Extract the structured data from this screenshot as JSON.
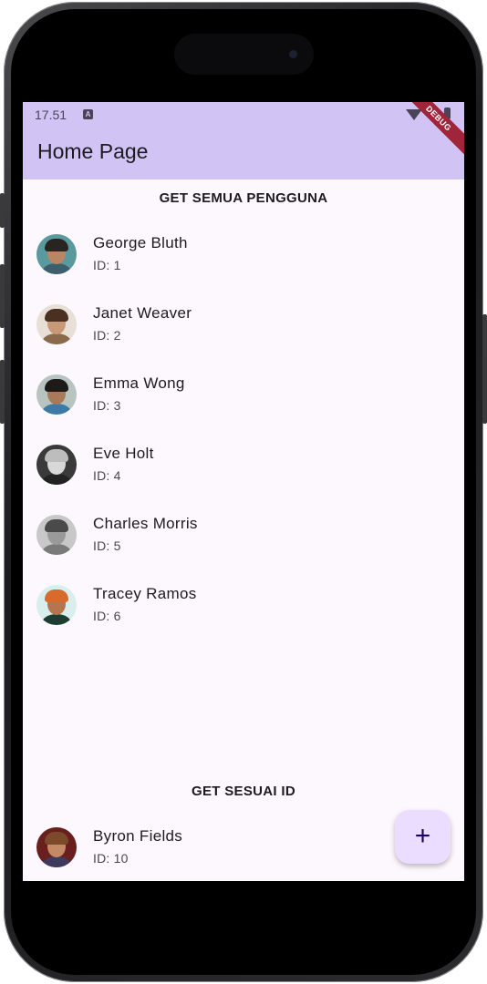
{
  "status_bar": {
    "time": "17.51",
    "badge": "A"
  },
  "appbar": {
    "title": "Home Page",
    "debug_banner": "DEBUG"
  },
  "sections": {
    "all_users_title": "GET SEMUA PENGGUNA",
    "by_id_title": "GET SESUAI ID"
  },
  "users": [
    {
      "name": "George Bluth",
      "id_text": "ID: 1"
    },
    {
      "name": "Janet Weaver",
      "id_text": "ID: 2"
    },
    {
      "name": "Emma Wong",
      "id_text": "ID: 3"
    },
    {
      "name": "Eve Holt",
      "id_text": "ID: 4"
    },
    {
      "name": "Charles Morris",
      "id_text": "ID: 5"
    },
    {
      "name": "Tracey Ramos",
      "id_text": "ID: 6"
    }
  ],
  "single_user": {
    "name": "Byron Fields",
    "id_text": "ID: 10"
  },
  "fab": {
    "icon": "plus-icon",
    "label": "+"
  },
  "colors": {
    "appbar": "#d1c4f5",
    "background": "#fdf7fe",
    "fab": "#eaddff",
    "debug": "#a0243a"
  }
}
